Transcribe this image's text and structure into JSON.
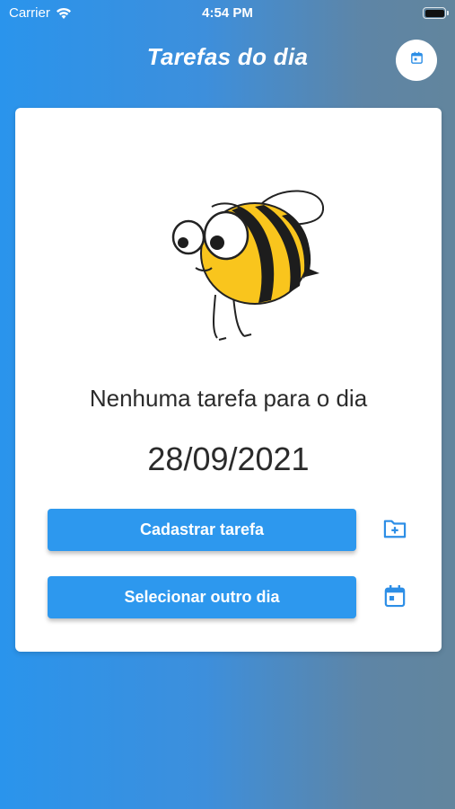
{
  "status_bar": {
    "carrier": "Carrier",
    "time": "4:54 PM",
    "wifi_icon": "wifi-icon",
    "battery_icon": "battery-icon"
  },
  "header": {
    "title": "Tarefas do dia",
    "calendar_button_icon": "calendar-icon"
  },
  "card": {
    "illustration": "bee-illustration",
    "empty_message": "Nenhuma tarefa para o dia",
    "date": "28/09/2021",
    "buttons": {
      "register_label": "Cadastrar tarefa",
      "register_icon": "folder-add-icon",
      "select_day_label": "Selecionar outro dia",
      "select_day_icon": "calendar-icon"
    }
  },
  "colors": {
    "background_gradient_start": "#2a94ec",
    "background_gradient_end": "#62859d",
    "primary_button": "#2d98ee",
    "icon_blue": "#2d8ee6",
    "card_background": "#ffffff"
  }
}
